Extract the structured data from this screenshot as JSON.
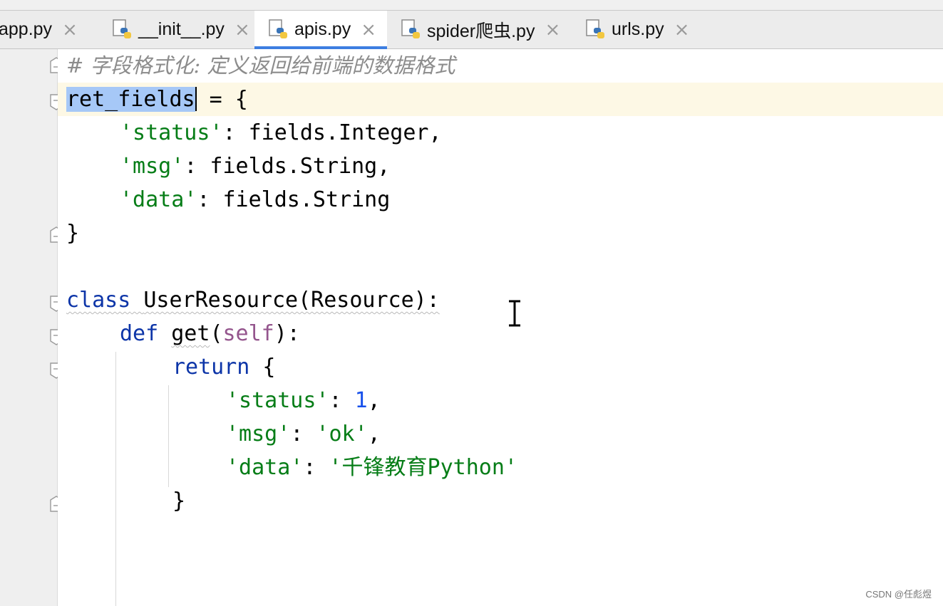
{
  "tabs": [
    {
      "label": "app.py",
      "active": false
    },
    {
      "label": "__init__.py",
      "active": false
    },
    {
      "label": "apis.py",
      "active": true
    },
    {
      "label": "spider爬虫.py",
      "active": false
    },
    {
      "label": "urls.py",
      "active": false
    }
  ],
  "close_glyph": "×",
  "code": {
    "comment": "# 字段格式化: 定义返回给前端的数据格式",
    "l2_var": "ret_fields",
    "l2_rest": " = {",
    "l3_key": "'status'",
    "l3_rest": ": fields.Integer,",
    "l4_key": "'msg'",
    "l4_rest": ": fields.String,",
    "l5_key": "'data'",
    "l5_rest": ": fields.String",
    "l6": "}",
    "l8_kw": "class",
    "l8_name": "UserResource(Resource):",
    "l9_kw": "def",
    "l9_fn": "get",
    "l9_open": "(",
    "l9_self": "self",
    "l9_close": "):",
    "l10_kw": "return",
    "l10_rest": " {",
    "l11_key": "'status'",
    "l11_sep": ": ",
    "l11_val": "1",
    "l11_end": ",",
    "l12_key": "'msg'",
    "l12_sep": ": ",
    "l12_val": "'ok'",
    "l12_end": ",",
    "l13_key": "'data'",
    "l13_sep": ": ",
    "l13_val": "'千锋教育Python'",
    "l14": "}"
  },
  "watermark": "CSDN @任彪煜",
  "colors": {
    "keyword": "#0d35a8",
    "string": "#067d17",
    "number": "#1750eb",
    "self": "#94558d",
    "comment": "#8c8c8c",
    "selection": "#a6c8f7",
    "active_tab_underline": "#3d7ee1"
  }
}
